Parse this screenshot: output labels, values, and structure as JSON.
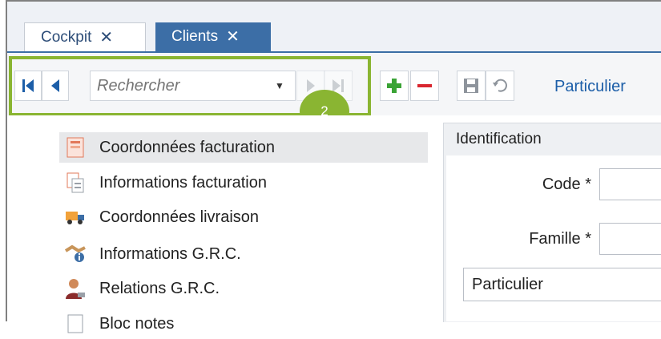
{
  "tabs": [
    {
      "label": "Cockpit",
      "close": "✕"
    },
    {
      "label": "Clients",
      "close": "✕"
    }
  ],
  "toolbar": {
    "search_placeholder": "Rechercher",
    "record_type": "Particulier"
  },
  "annotation": {
    "badge": "2",
    "color": "#8ab532"
  },
  "sidebar": {
    "items": [
      {
        "label": "Coordonnées facturation",
        "icon": "billing-doc-icon",
        "selected": true
      },
      {
        "label": "Informations facturation",
        "icon": "invoice-info-icon",
        "selected": false
      },
      {
        "label": "Coordonnées livraison",
        "icon": "delivery-truck-icon",
        "selected": false
      },
      {
        "label": "Informations G.R.C.",
        "icon": "handshake-info-icon",
        "selected": false
      },
      {
        "label": "Relations G.R.C.",
        "icon": "contact-person-icon",
        "selected": false
      },
      {
        "label": "Bloc notes",
        "icon": "notepad-icon",
        "selected": false
      }
    ]
  },
  "identification": {
    "title": "Identification",
    "code_label": "Code *",
    "famille_label": "Famille *",
    "type_value": "Particulier"
  },
  "colors": {
    "accent": "#3c6ea6",
    "green": "#8ab532",
    "red": "#d9262f",
    "link": "#1c5ea8"
  }
}
